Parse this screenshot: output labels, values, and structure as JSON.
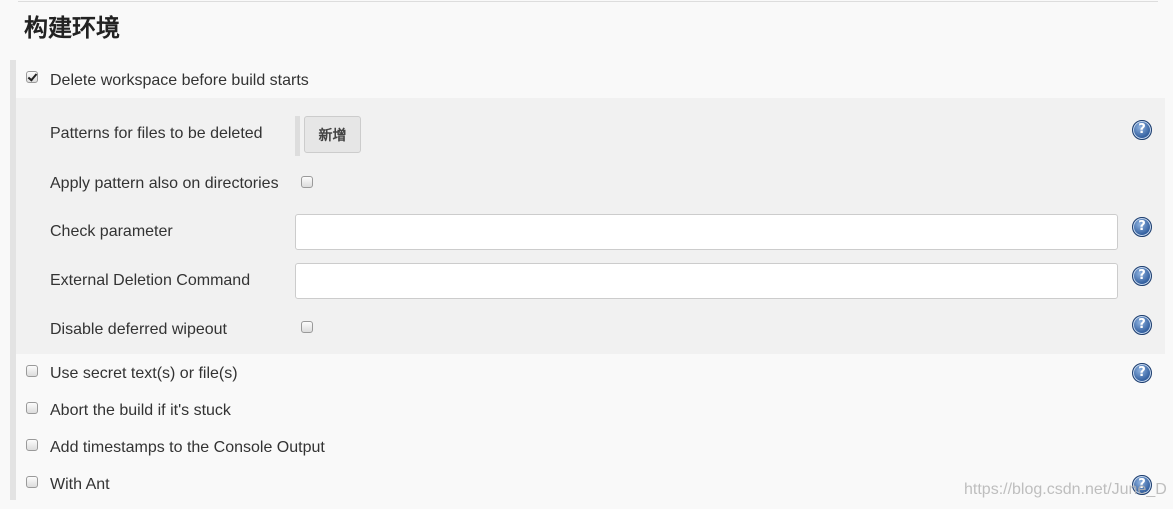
{
  "section": {
    "title": "构建环境"
  },
  "delete_workspace": {
    "label": "Delete workspace before build starts",
    "checked": true,
    "fields": {
      "patterns_label": "Patterns for files to be deleted",
      "add_button": "新增",
      "apply_dirs_label": "Apply pattern also on directories",
      "apply_dirs_checked": false,
      "check_param_label": "Check parameter",
      "check_param_value": "",
      "external_cmd_label": "External Deletion Command",
      "external_cmd_value": "",
      "disable_wipeout_label": "Disable deferred wipeout",
      "disable_wipeout_checked": false
    }
  },
  "options": [
    {
      "label": "Use secret text(s) or file(s)",
      "checked": false,
      "help": true
    },
    {
      "label": "Abort the build if it's stuck",
      "checked": false,
      "help": false
    },
    {
      "label": "Add timestamps to the Console Output",
      "checked": false,
      "help": false
    },
    {
      "label": "With Ant",
      "checked": false,
      "help": true
    }
  ],
  "help_glyph": "?",
  "watermark": "https://blog.csdn.net/June_D"
}
